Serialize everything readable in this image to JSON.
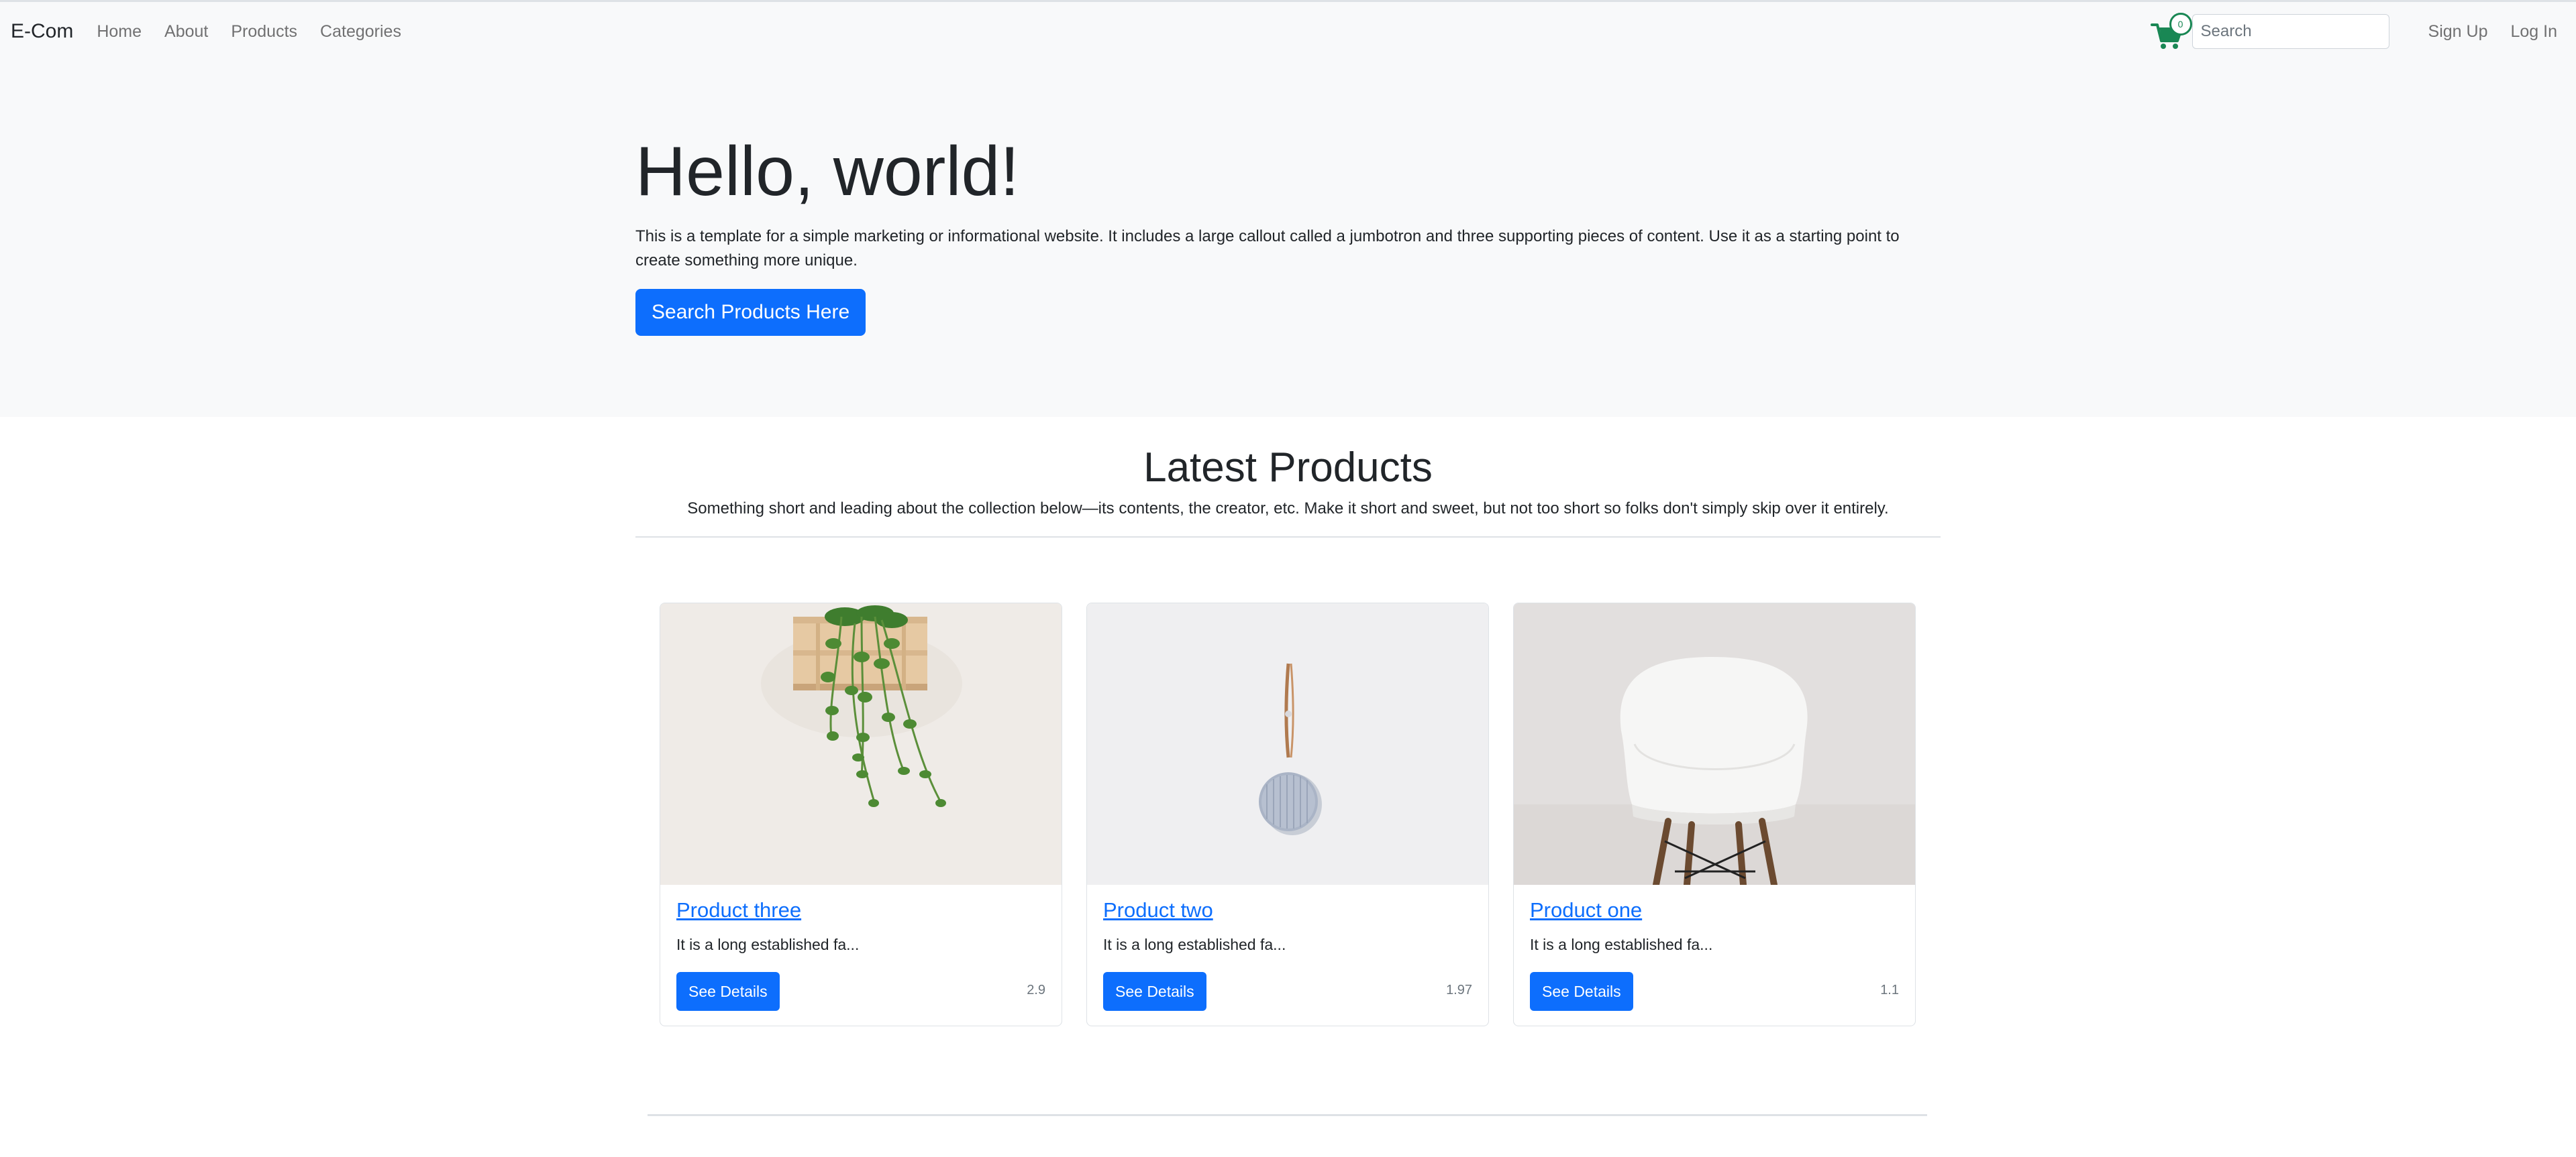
{
  "navbar": {
    "brand": "E-Com",
    "links": [
      "Home",
      "About",
      "Products",
      "Categories"
    ],
    "cart_count": "0",
    "search_placeholder": "Search",
    "signup": "Sign Up",
    "login": "Log In"
  },
  "jumbotron": {
    "title": "Hello, world!",
    "text": "This is a template for a simple marketing or informational website. It includes a large callout called a jumbotron and three supporting pieces of content. Use it as a starting point to create something more unique.",
    "button": "Search Products Here"
  },
  "latest": {
    "title": "Latest Products",
    "lead": "Something short and leading about the collection below—its contents, the creator, etc. Make it short and sweet, but not too short so folks don't simply skip over it entirely."
  },
  "products": [
    {
      "title": "Product three",
      "text": "It is a long established fa...",
      "button": "See Details",
      "price": "2.9",
      "image": "hanging-plant-shelf"
    },
    {
      "title": "Product two",
      "text": "It is a long established fa...",
      "button": "See Details",
      "price": "1.97",
      "image": "round-speaker"
    },
    {
      "title": "Product one",
      "text": "It is a long established fa...",
      "button": "See Details",
      "price": "1.1",
      "image": "white-chair"
    }
  ],
  "colors": {
    "primary": "#0d6efd",
    "cart": "#198754",
    "light_bg": "#f8f9fa"
  }
}
